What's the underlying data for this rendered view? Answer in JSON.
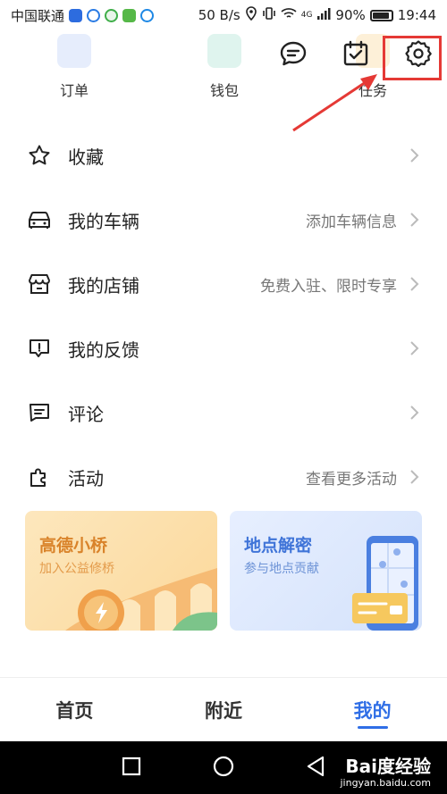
{
  "status_bar": {
    "carrier": "中国联通",
    "speed": "50 B/s",
    "network": "4G",
    "battery": "90%",
    "time": "19:44"
  },
  "top_grid": [
    {
      "label": "订单"
    },
    {
      "label": "钱包"
    },
    {
      "label": "任务"
    }
  ],
  "menu": [
    {
      "icon": "star-icon",
      "label": "收藏",
      "hint": ""
    },
    {
      "icon": "car-icon",
      "label": "我的车辆",
      "hint": "添加车辆信息"
    },
    {
      "icon": "store-icon",
      "label": "我的店铺",
      "hint": "免费入驻、限时专享"
    },
    {
      "icon": "feedback-icon",
      "label": "我的反馈",
      "hint": ""
    },
    {
      "icon": "comment-icon",
      "label": "评论",
      "hint": ""
    },
    {
      "icon": "puzzle-icon",
      "label": "活动",
      "hint": "查看更多活动"
    }
  ],
  "cards": [
    {
      "title": "高德小桥",
      "subtitle": "加入公益修桥"
    },
    {
      "title": "地点解密",
      "subtitle": "参与地点贡献"
    }
  ],
  "bottom_nav": [
    {
      "label": "首页",
      "active": false
    },
    {
      "label": "附近",
      "active": false
    },
    {
      "label": "我的",
      "active": true
    }
  ],
  "watermark": {
    "brand": "Bai度经验",
    "url": "jingyan.baidu.com"
  },
  "colors": {
    "accent": "#2f6ee6",
    "highlight": "#e53935"
  }
}
